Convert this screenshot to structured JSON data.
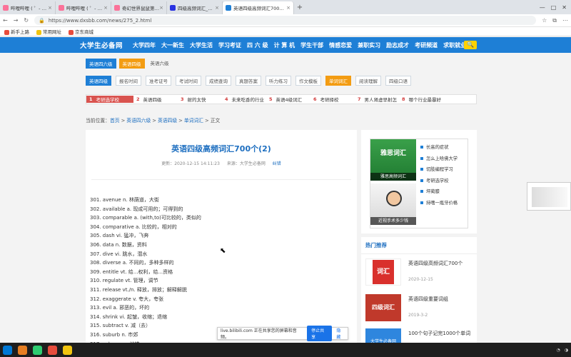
{
  "tabs": [
    {
      "label": "哔哩哔哩 ( ゜- ゜)つロ 干杯~-bili",
      "color": "#fb7299"
    },
    {
      "label": "哔哩哔哩 ( ゜- ゜)つロ 干杯~-bili",
      "color": "#fb7299"
    },
    {
      "label": "奇幻世界鼠鼠第11集-最弱-无比",
      "color": "#fb7299"
    },
    {
      "label": "四级高频词汇_百度搜索",
      "color": "#2932e1"
    },
    {
      "label": "英语四级高频词汇700个 - 第2页",
      "color": "#1e7fd6",
      "active": true
    }
  ],
  "url": "https://www.dxsbb.com/news/275_2.html",
  "bookmarks": [
    "新手上路",
    "常用网址",
    "京东商城"
  ],
  "site": {
    "logo": "大学生必备网",
    "nav": [
      "大学四年",
      "大一新生",
      "大学生活",
      "学习考证",
      "四 六 级",
      "计 算 机",
      "学生干部",
      "情感恋爱",
      "兼职实习",
      "励志成才",
      "考研频道",
      "求职就业"
    ]
  },
  "subtabs": [
    "英语四六级",
    "英语四级",
    "英语六级"
  ],
  "filters": [
    "英语四级",
    "报名时间",
    "准考证号",
    "考试时间",
    "成绩查询",
    "真题答案",
    "听力练习",
    "作文模板",
    "单词词汇",
    "阅读理解",
    "四级口语"
  ],
  "ranks": [
    {
      "n": "1",
      "t": "考研选学校"
    },
    {
      "n": "2",
      "t": "英语四级"
    },
    {
      "n": "3",
      "t": "射的太快"
    },
    {
      "n": "4",
      "t": "未来吃香的行业"
    },
    {
      "n": "5",
      "t": "英语4级词汇"
    },
    {
      "n": "6",
      "t": "考研择校"
    },
    {
      "n": "7",
      "t": "男人肾虚早射怎"
    },
    {
      "n": "8",
      "t": "哪个行业最暴好"
    }
  ],
  "breadcrumb": {
    "prefix": "当前位置：",
    "items": [
      "首页",
      "英语四六级",
      "英语四级",
      "单词词汇",
      "正文"
    ],
    "sep": ">"
  },
  "article": {
    "title": "英语四级高频词汇700个(2)",
    "date": "更新：2020-12-15 14:11:23",
    "source": "来源：大学生必备网",
    "tag": "纠错",
    "words": [
      "301. avenue n. 林荫道，大街",
      "302. available a. 现成可用的；可得到的",
      "303. comparable a. (with,to)可比较的，类似的",
      "304. comparative a. 比较的，相对的",
      "305. dash vi. 猛冲，飞奔",
      "306. data n. 数据，资料",
      "307. dive vi. 跳水，潜水",
      "308. diverse a. 不同的，多种多样的",
      "309. entitle vt. 给...权利，给...资格",
      "310. regulate vt. 管理，调节",
      "311. release vt./n. 释放，排放；解释解脱",
      "312. exaggerate v. 夸大，夸张",
      "313. evil a. 邪恶的，坏的",
      "314. shrink vi. 起皱，收缩；退缩",
      "315. subtract v. 减（去）",
      "316. suburb n. 市郊",
      "317. subway n. 地铁"
    ]
  },
  "ad": {
    "img1_caption": "雅思高频词汇",
    "img1_text": "雅思词汇",
    "img2_caption": "近视手术多少钱",
    "links": [
      "长高的症状",
      "怎么上哈佛大学",
      "切肢编程学习",
      "考研选学校",
      "坪蔺膝",
      "持嗜一瓶牙价格"
    ]
  },
  "hot": {
    "title": "热门推荐",
    "items": [
      {
        "title": "英语四级高频词汇700个",
        "date": "2020-12-15",
        "thumb": "词汇"
      },
      {
        "title": "英语四级重要词组",
        "date": "2019-3-2",
        "thumb": "四级词汇"
      },
      {
        "title": "100个句子记完1000个单词",
        "date": "",
        "thumb": "大学生必备网"
      }
    ]
  },
  "share": {
    "text": "live.bilibili.com 正在共享您的屏幕和音频。",
    "stop": "停止共享",
    "hide": "隐藏"
  },
  "colors": {
    "brand": "#1e7fd6",
    "accent": "#f39c12",
    "rank_hot": "#d9534f"
  }
}
